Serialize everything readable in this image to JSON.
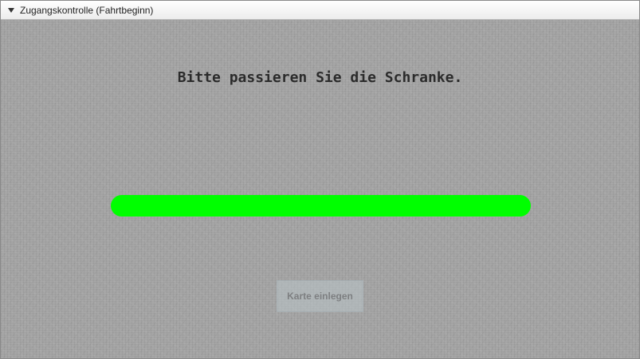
{
  "window": {
    "title": "Zugangskontrolle (Fahrtbeginn)"
  },
  "main": {
    "message": "Bitte passieren Sie die Schranke.",
    "status_bar_color": "#00ff00",
    "card_button_label": "Karte einlegen"
  },
  "icons": {
    "collapse": "triangle-down"
  }
}
